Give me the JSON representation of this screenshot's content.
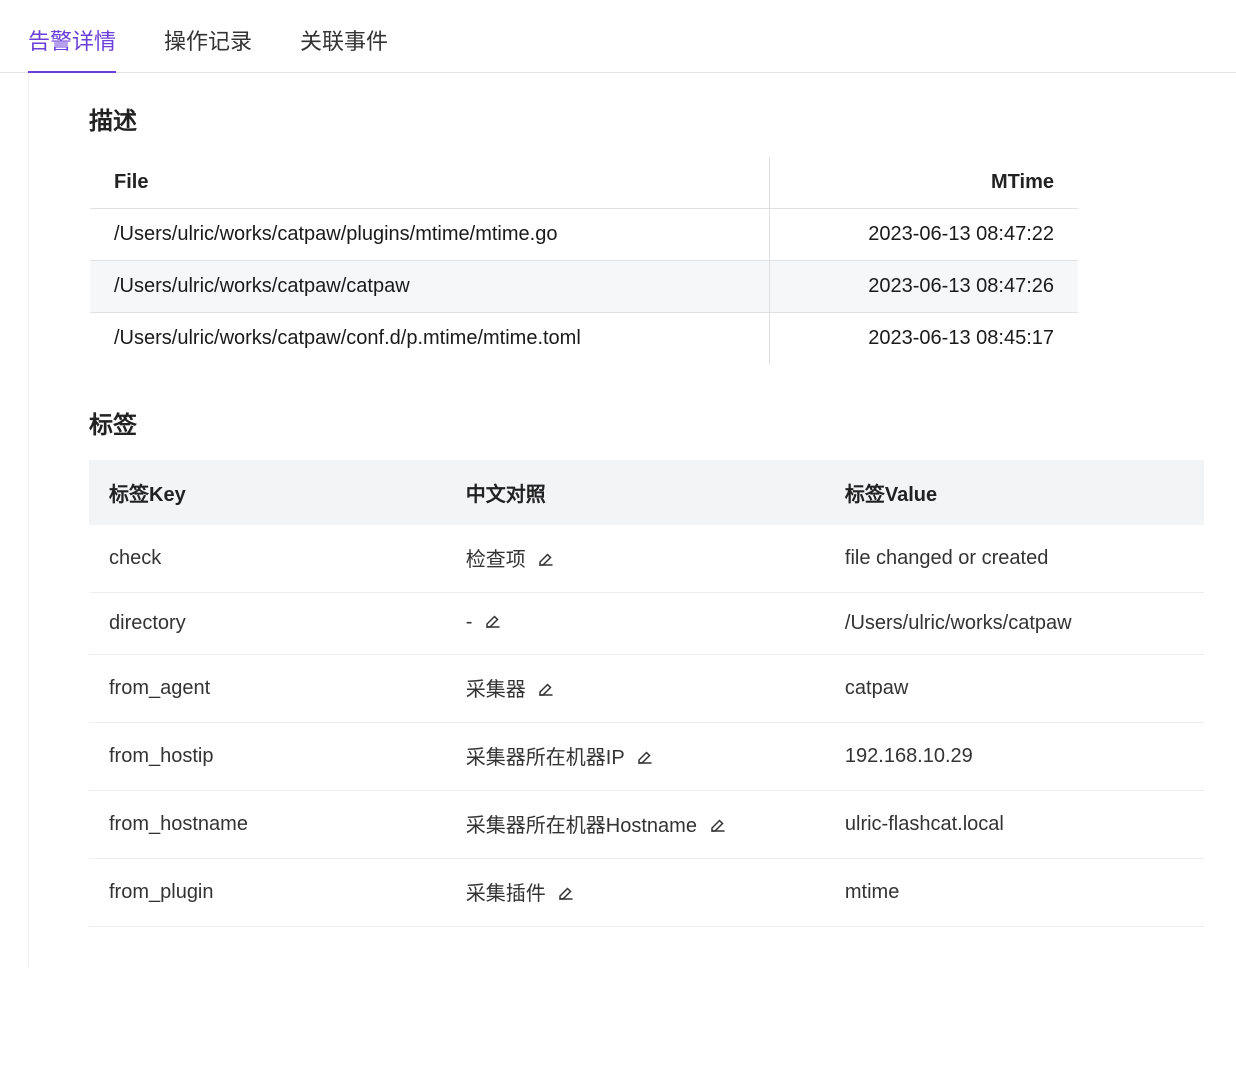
{
  "tabs": [
    {
      "label": "告警详情",
      "active": true
    },
    {
      "label": "操作记录",
      "active": false
    },
    {
      "label": "关联事件",
      "active": false
    }
  ],
  "sections": {
    "description_title": "描述",
    "tags_title": "标签"
  },
  "desc_table": {
    "headers": {
      "file": "File",
      "mtime": "MTime"
    },
    "rows": [
      {
        "file": "/Users/ulric/works/catpaw/plugins/mtime/mtime.go",
        "mtime": "2023-06-13 08:47:22"
      },
      {
        "file": "/Users/ulric/works/catpaw/catpaw",
        "mtime": "2023-06-13 08:47:26"
      },
      {
        "file": "/Users/ulric/works/catpaw/conf.d/p.mtime/mtime.toml",
        "mtime": "2023-06-13 08:45:17"
      }
    ]
  },
  "tags_table": {
    "headers": {
      "key": "标签Key",
      "zh": "中文对照",
      "value": "标签Value"
    },
    "rows": [
      {
        "key": "check",
        "zh": "检查项",
        "value": "file changed or created"
      },
      {
        "key": "directory",
        "zh": "-",
        "value": "/Users/ulric/works/catpaw"
      },
      {
        "key": "from_agent",
        "zh": "采集器",
        "value": "catpaw"
      },
      {
        "key": "from_hostip",
        "zh": "采集器所在机器IP",
        "value": "192.168.10.29"
      },
      {
        "key": "from_hostname",
        "zh": "采集器所在机器Hostname",
        "value": "ulric-flashcat.local"
      },
      {
        "key": "from_plugin",
        "zh": "采集插件",
        "value": "mtime"
      }
    ]
  }
}
